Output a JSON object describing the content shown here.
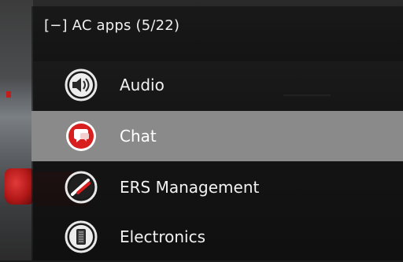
{
  "panel": {
    "header": "[−] AC apps (5/22)"
  },
  "apps": [
    {
      "label": "Audio",
      "icon": "speaker-icon",
      "selected": false
    },
    {
      "label": "Chat",
      "icon": "chat-bubble-icon",
      "selected": true
    },
    {
      "label": "ERS Management",
      "icon": "ers-gauge-icon",
      "selected": false
    },
    {
      "label": "Electronics",
      "icon": "electronics-chip-icon",
      "selected": false
    }
  ],
  "colors": {
    "selected_row": "#8a8a8a",
    "chat_icon_red": "#d81f1f",
    "text": "#f2f2f2"
  }
}
